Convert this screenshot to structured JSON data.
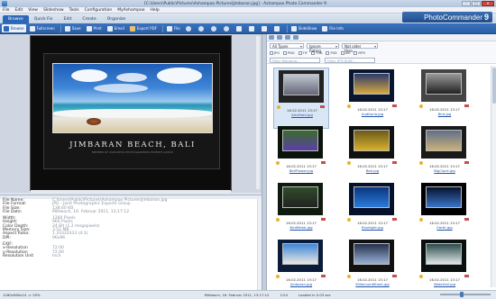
{
  "window": {
    "title": "[C:\\Users\\Public\\Pictures\\Ashampoo Pictures\\Jimbaran.jpg] - Ashampoo Photo Commander 9"
  },
  "brand": {
    "name": "PhotoCommander",
    "version": "9"
  },
  "menu": [
    "File",
    "Edit",
    "View",
    "Slideshow",
    "Tools",
    "Configuration",
    "MyAshampoo",
    "Help"
  ],
  "tabs": [
    "Browse",
    "Quick Fix",
    "Edit",
    "Create",
    "Organize"
  ],
  "toolbar": {
    "first": "Browse",
    "buttons": [
      "Fullscreen",
      "Save",
      "Print",
      "Email",
      "Export PDF",
      "File",
      "SlideShow",
      "File Info"
    ]
  },
  "viewer": {
    "caption": "JIMBARAN BEACH, BALI",
    "subcaption": "MEMBER OF ASHAMPOO PHOTOGRAPHERS EXPERTS GROUP"
  },
  "info": {
    "rows1": [
      [
        "File Name:",
        "C:\\Users\\Public\\Pictures\\Ashampoo Pictures\\Jimbaran.jpg"
      ],
      [
        "File Format:",
        "JPG - Joint Photographic Experts Group"
      ],
      [
        "File Size:",
        "138.60 KB"
      ],
      [
        "File Date:",
        "Mittwoch, 16. Februar 2011, 13:17:12"
      ]
    ],
    "rows2": [
      [
        "Width:",
        "1280 Pixels"
      ],
      [
        "Height:",
        "960 Pixels"
      ],
      [
        "Color Depth:",
        "24 Bit (1.2 megapixels)"
      ],
      [
        "Memory Size:",
        "3.52 MB"
      ],
      [
        "Aspect Ratio:",
        "1.33333333 (4:3)"
      ],
      [
        "DPI:",
        "96x96"
      ]
    ],
    "exif": "EXIF:",
    "rows3": [
      [
        "x-Resolution",
        "72.00"
      ],
      [
        "y-Resolution",
        "72.00"
      ],
      [
        "Resolution Unit",
        "Inch"
      ]
    ]
  },
  "browser": {
    "type_filter": "All Types",
    "rating_filter": "Ignore Rating",
    "age_filter": "Not older than...",
    "extensions": [
      "JPG",
      "PNG",
      "TIF",
      "TGA",
      "PSD",
      "AVI",
      "MP3"
    ],
    "search_name": "Filter filename...",
    "search_iptc": "Filter IPTC/EXIF...",
    "items": [
      {
        "date": "16.02.2011 13:17",
        "name": "ArtsFeed.jpg"
      },
      {
        "date": "16.02.2011 13:17",
        "name": "Auditoria.jpg"
      },
      {
        "date": "16.02.2011 13:17",
        "name": "Bird.jpg"
      },
      {
        "date": "16.02.2011 13:17",
        "name": "BellFlower.jpg"
      },
      {
        "date": "16.02.2011 13:17",
        "name": "Bee.jpg"
      },
      {
        "date": "16.02.2011 13:17",
        "name": "BigClock.jpg"
      },
      {
        "date": "16.02.2011 13:17",
        "name": "BirdMetal.jpg"
      },
      {
        "date": "16.02.2011 13:17",
        "name": "Bluelight.jpg"
      },
      {
        "date": "16.02.2011 13:17",
        "name": "Earth.jpg"
      },
      {
        "date": "16.02.2011 13:17",
        "name": "Jimbaran.jpg"
      },
      {
        "date": "16.02.2011 13:17",
        "name": "MilleniumWheel.jpg"
      },
      {
        "date": "16.02.2011 13:17",
        "name": "Waterfall.jpg"
      }
    ]
  },
  "status": {
    "dims": "1280x960x24 -> 55%",
    "date": "Mittwoch, 16. Februar 2011, 13:17:12",
    "count": "2:54",
    "loaded": "Loaded in 0.03 sec"
  }
}
